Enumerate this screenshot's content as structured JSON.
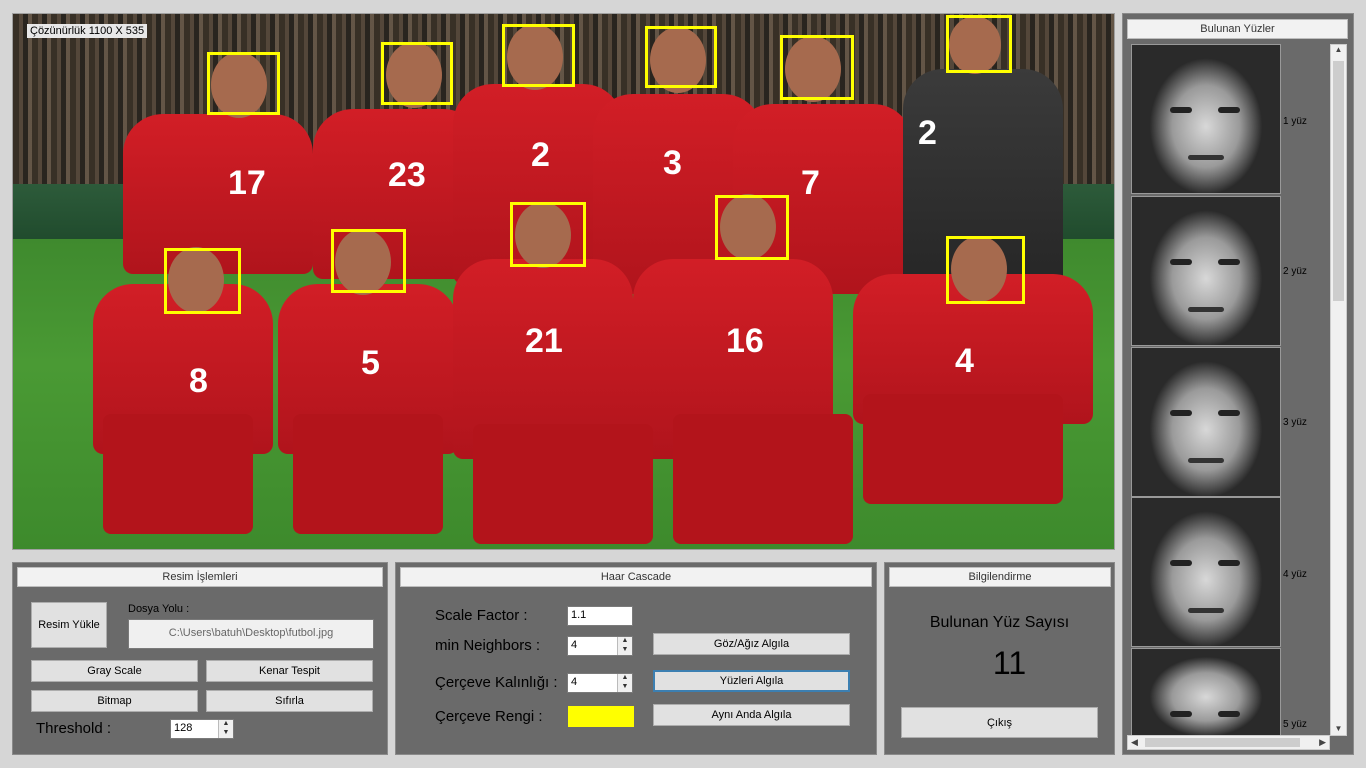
{
  "image": {
    "resolution_label": "Çözünürlük  1100 X 535",
    "jersey_numbers": [
      "17",
      "23",
      "2",
      "3",
      "7",
      "2",
      "8",
      "5",
      "21",
      "16",
      "4"
    ]
  },
  "resim": {
    "title": "Resim İşlemleri",
    "load_button": "Resim Yükle",
    "path_label": "Dosya Yolu :",
    "path_value": "C:\\Users\\batuh\\Desktop\\futbol.jpg",
    "gray_button": "Gray Scale",
    "edge_button": "Kenar Tespit",
    "bitmap_button": "Bitmap",
    "reset_button": "Sıfırla",
    "threshold_label": "Threshold :",
    "threshold_value": "128"
  },
  "haar": {
    "title": "Haar Cascade",
    "scale_label": "Scale Factor :",
    "scale_value": "1.1",
    "neighbors_label": "min Neighbors :",
    "neighbors_value": "4",
    "thickness_label": "Çerçeve Kalınlığı :",
    "thickness_value": "4",
    "color_label": "Çerçeve Rengi :",
    "frame_color": "#ffff00",
    "eye_button": "Göz/Ağız Algıla",
    "face_button": "Yüzleri Algıla",
    "both_button": "Aynı Anda Algıla"
  },
  "info": {
    "title": "Bilgilendirme",
    "count_label": "Bulunan Yüz Sayısı",
    "count_value": "11",
    "exit_button": "Çıkış"
  },
  "faces": {
    "title": "Bulunan Yüzler",
    "items": [
      {
        "label": "1 yüz"
      },
      {
        "label": "2 yüz"
      },
      {
        "label": "3 yüz"
      },
      {
        "label": "4 yüz"
      },
      {
        "label": "5 yüz"
      }
    ]
  }
}
